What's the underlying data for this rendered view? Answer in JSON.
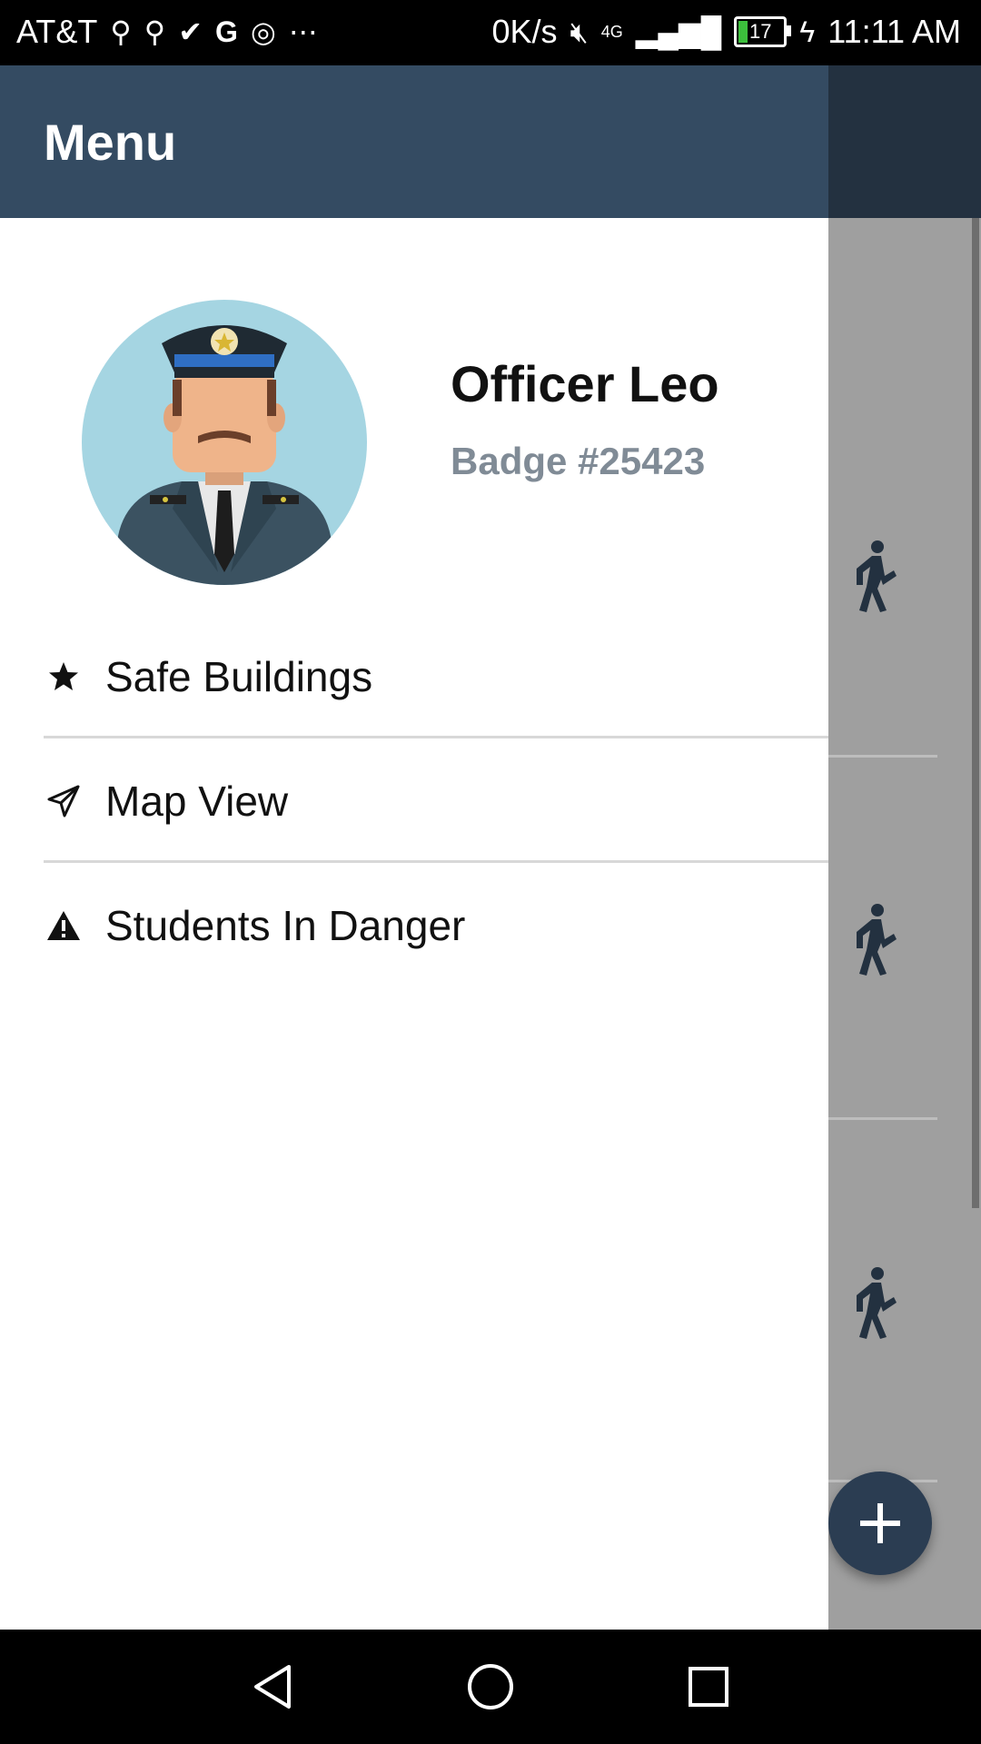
{
  "status_bar": {
    "carrier": "AT&T",
    "net_speed": "0K/s",
    "network": "4G LTE",
    "battery": "17",
    "time": "11:11 AM"
  },
  "drawer": {
    "title": "Menu",
    "profile": {
      "name": "Officer Leo",
      "badge": "Badge #25423"
    },
    "items": [
      {
        "label": "Safe Buildings",
        "icon": "star-icon"
      },
      {
        "label": "Map View",
        "icon": "paper-plane-icon"
      },
      {
        "label": "Students In Danger",
        "icon": "warning-icon"
      }
    ]
  },
  "colors": {
    "drawer_header": "#344b62",
    "app_header": "#233140",
    "fab": "#2b3d52",
    "badge_text": "#808b96"
  }
}
